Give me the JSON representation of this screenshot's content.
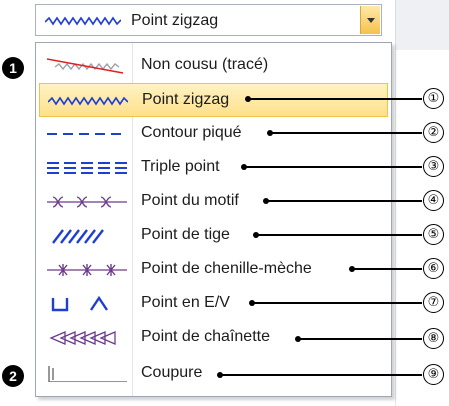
{
  "combo": {
    "selected_label": "Point zigzag",
    "icon": "zigzag-stitch-icon",
    "dropdown_icon": "chevron-down-icon"
  },
  "dropdown": {
    "items": [
      {
        "label": "Non cousu (tracé)",
        "icon": "not-sewn-stitch-icon"
      },
      {
        "label": "Point zigzag",
        "icon": "zigzag-stitch-icon",
        "selected": true
      },
      {
        "label": "Contour piqué",
        "icon": "running-stitch-icon"
      },
      {
        "label": "Triple point",
        "icon": "triple-stitch-icon"
      },
      {
        "label": "Point du motif",
        "icon": "motif-stitch-icon"
      },
      {
        "label": "Point de tige",
        "icon": "stem-stitch-icon"
      },
      {
        "label": "Point de chenille-mèche",
        "icon": "candlewicking-stitch-icon"
      },
      {
        "label": "Point en E/V",
        "icon": "ev-stitch-icon"
      },
      {
        "label": "Point de chaînette",
        "icon": "chain-stitch-icon"
      },
      {
        "label": "Coupure",
        "icon": "cut-icon"
      }
    ]
  },
  "callouts": [
    "①",
    "②",
    "③",
    "④",
    "⑤",
    "⑥",
    "⑦",
    "⑧",
    "⑨"
  ],
  "markers": [
    "1",
    "2"
  ],
  "colors": {
    "stitch_blue": "#1f3fd0",
    "motif_purple": "#6b3a8c",
    "highlight": "#fde08a",
    "not_sewn_red": "#e02020"
  }
}
